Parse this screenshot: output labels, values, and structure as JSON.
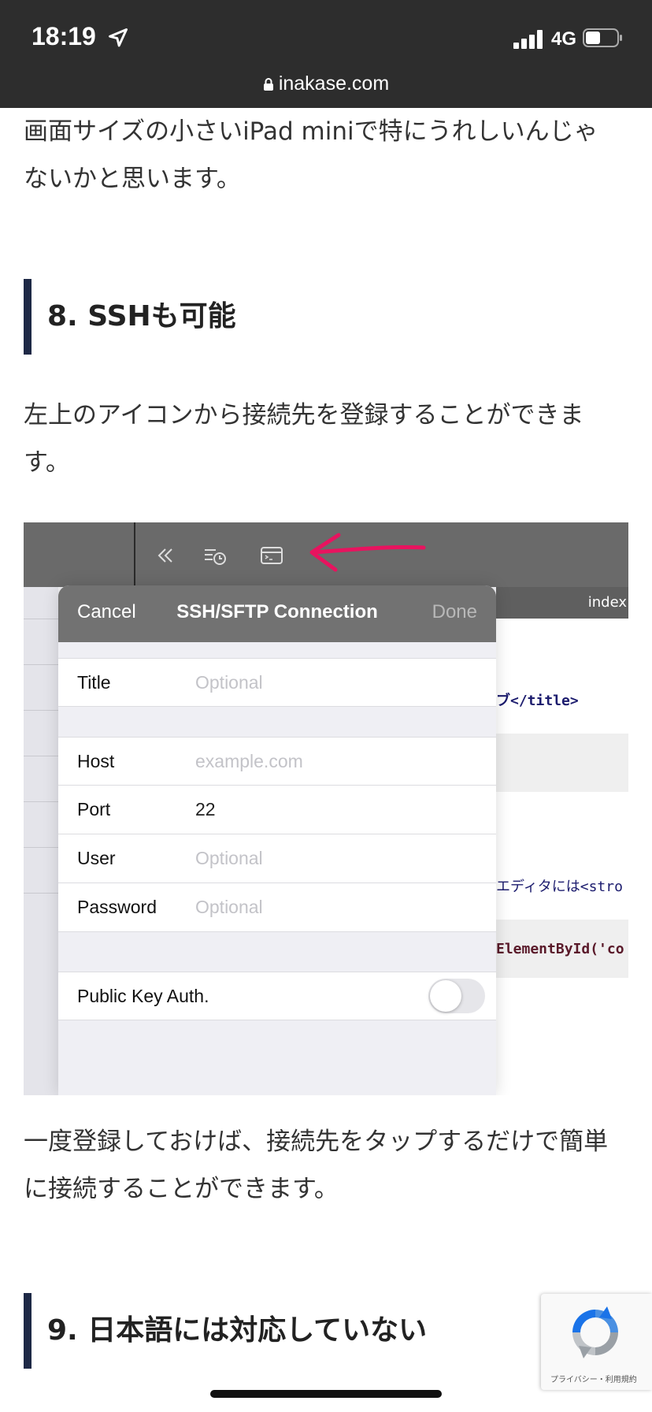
{
  "status": {
    "time": "18:19",
    "network": "4G",
    "url": "inakase.com"
  },
  "article": {
    "para_top_line1": "画面サイズの小さいiPad miniで特にうれしいんじゃ",
    "para_top_line2": "ないかと思います。",
    "h2_8": "8. SSHも可能",
    "para_8_line1": "左上のアイコンから接続先を登録することができま",
    "para_8_line2": "す。",
    "para_after_line1": "一度登録しておけば、接続先をタップするだけで簡単",
    "para_after_line2": "に接続することができます。",
    "h2_9": "9. 日本語には対応していない"
  },
  "screenshot": {
    "right_header": "index",
    "code_lines": [
      {
        "text": "ブ</title>"
      },
      {
        "text": "エディタには<stro"
      },
      {
        "text": "ElementById('co"
      }
    ],
    "modal": {
      "cancel": "Cancel",
      "title": "SSH/SFTP Connection",
      "done": "Done",
      "fields": [
        {
          "label": "Title",
          "value": "Optional",
          "placeholder": true
        },
        {
          "label": "Host",
          "value": "example.com",
          "placeholder": true
        },
        {
          "label": "Port",
          "value": "22",
          "placeholder": false
        },
        {
          "label": "User",
          "value": "Optional",
          "placeholder": true
        },
        {
          "label": "Password",
          "value": "Optional",
          "placeholder": true
        }
      ],
      "public_key_label": "Public Key Auth.",
      "public_key_enabled": false
    },
    "colors": {
      "arrow": "#e8135f"
    }
  },
  "recaptcha": {
    "text": "プライバシー・利用規約"
  }
}
